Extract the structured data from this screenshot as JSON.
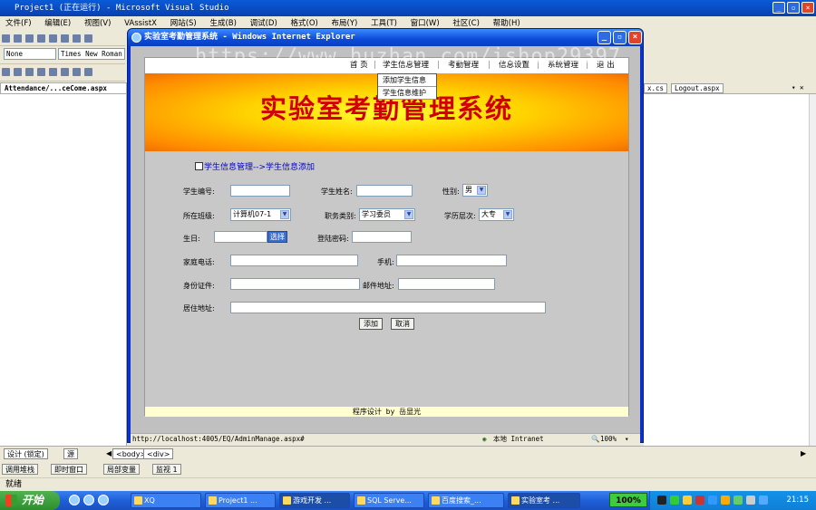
{
  "vs": {
    "title": "Project1 (正在运行) - Microsoft Visual Studio",
    "menu": [
      "文件(F)",
      "编辑(E)",
      "视图(V)",
      "VAssistX",
      "网站(S)",
      "生成(B)",
      "调试(D)",
      "格式(O)",
      "布局(Y)",
      "工具(T)",
      "窗口(W)",
      "社区(C)",
      "帮助(H)"
    ],
    "combo_style": "None",
    "combo_font": "Times New Roman",
    "doc_tab": "Attendance/...ceCome.aspx",
    "right_tabs": [
      "x.cs",
      "Logout.aspx"
    ],
    "design_tab": "设计 (锁定)",
    "source_tab": "源",
    "tag_body": "<body>",
    "tag_div": "<div>",
    "output_tabs": [
      "调用堆栈",
      "即时窗口",
      "局部变量",
      "监视 1"
    ],
    "status": "就绪"
  },
  "ie": {
    "title": "实验室考勤管理系统 - Windows Internet Explorer",
    "status_url": "http://localhost:4005/EQ/AdminManage.aspx#",
    "zone": "本地 Intranet",
    "zoom": "100%"
  },
  "page": {
    "nav": [
      "首 页",
      "学生信息管理",
      "考勤管理",
      "信息设置",
      "系统管理",
      "退 出"
    ],
    "submenu": [
      "添加学生信息",
      "学生信息维护"
    ],
    "banner_title": "实验室考勤管理系统",
    "breadcrumb": "学生信息管理-->学生信息添加",
    "form": {
      "student_no": "学生编号:",
      "student_name": "学生姓名:",
      "gender": "性别:",
      "gender_value": "男",
      "class": "所在班级:",
      "class_value": "计算机07-1",
      "position": "职务类别:",
      "position_value": "学习委员",
      "education": "学历层次:",
      "education_value": "大专",
      "birthday": "生日:",
      "choose_button": "选择",
      "password": "登陆密码:",
      "home_phone": "家庭电话:",
      "mobile": "手机:",
      "id_card": "身份证件:",
      "email": "邮件地址:",
      "address": "居住地址:",
      "add_button": "添加",
      "cancel_button": "取消"
    },
    "footer": "程序设计 by 岳显光"
  },
  "watermark": "https://www.huzhan.com/ishop29397",
  "taskbar": {
    "start": "开始",
    "tasks": [
      "XQ",
      "Project1 ...",
      "游戏开发 ...",
      "SQL Serve...",
      "百度搜索_...",
      "实验室考 ..."
    ],
    "zoom": "100%",
    "clock": "21:15"
  }
}
